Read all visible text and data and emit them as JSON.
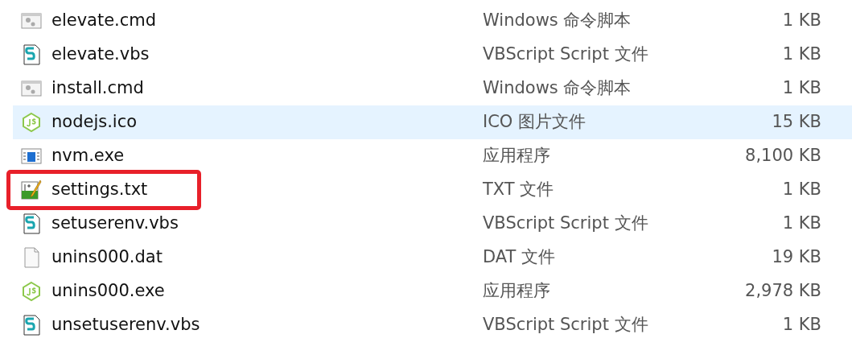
{
  "files": [
    {
      "kind": "cmd",
      "name": "elevate.cmd",
      "type": "Windows 命令脚本",
      "size": "1 KB",
      "hovered": false,
      "marked": false
    },
    {
      "kind": "vbs",
      "name": "elevate.vbs",
      "type": "VBScript Script 文件",
      "size": "1 KB",
      "hovered": false,
      "marked": false
    },
    {
      "kind": "cmd",
      "name": "install.cmd",
      "type": "Windows 命令脚本",
      "size": "1 KB",
      "hovered": false,
      "marked": false
    },
    {
      "kind": "node",
      "name": "nodejs.ico",
      "type": "ICO 图片文件",
      "size": "15 KB",
      "hovered": true,
      "marked": false
    },
    {
      "kind": "exe",
      "name": "nvm.exe",
      "type": "应用程序",
      "size": "8,100 KB",
      "hovered": false,
      "marked": false
    },
    {
      "kind": "txt",
      "name": "settings.txt",
      "type": "TXT 文件",
      "size": "1 KB",
      "hovered": false,
      "marked": true
    },
    {
      "kind": "vbs",
      "name": "setuserenv.vbs",
      "type": "VBScript Script 文件",
      "size": "1 KB",
      "hovered": false,
      "marked": false
    },
    {
      "kind": "blank",
      "name": "unins000.dat",
      "type": "DAT 文件",
      "size": "19 KB",
      "hovered": false,
      "marked": false
    },
    {
      "kind": "node",
      "name": "unins000.exe",
      "type": "应用程序",
      "size": "2,978 KB",
      "hovered": false,
      "marked": false
    },
    {
      "kind": "vbs",
      "name": "unsetuserenv.vbs",
      "type": "VBScript Script 文件",
      "size": "1 KB",
      "hovered": false,
      "marked": false
    }
  ]
}
